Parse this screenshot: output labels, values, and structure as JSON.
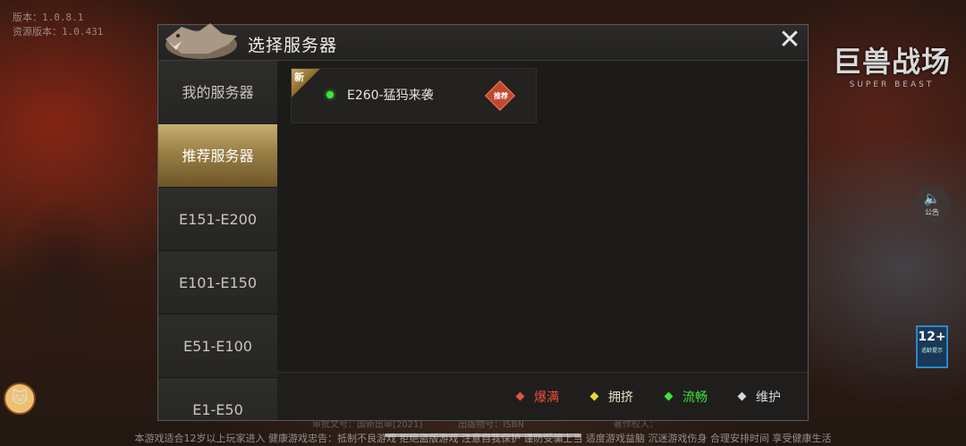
{
  "version_lines": [
    "版本：1.0.8.1",
    "资源版本：1.0.431"
  ],
  "logo": {
    "main": "巨兽战场",
    "sub": "SUPER BEAST"
  },
  "notice_label": "公告",
  "age_badge": {
    "num": "12+",
    "caption": "适龄提示"
  },
  "dialog": {
    "title": "选择服务器",
    "close_glyph": "✕",
    "sidebar": [
      {
        "label": "我的服务器",
        "active": false
      },
      {
        "label": "推荐服务器",
        "active": true
      },
      {
        "label": "E151-E200",
        "active": false
      },
      {
        "label": "E101-E150",
        "active": false
      },
      {
        "label": "E51-E100",
        "active": false
      },
      {
        "label": "E1-E50",
        "active": false
      }
    ],
    "server": {
      "new_tag": "新",
      "name": "E260-猛犸来袭",
      "status_color": "#3ce63c",
      "badge": "推荐"
    },
    "legend": [
      {
        "label": "爆满",
        "color": "#e8503c"
      },
      {
        "label": "拥挤",
        "color": "#e8d23c"
      },
      {
        "label": "流畅",
        "color": "#3ce63c"
      },
      {
        "label": "维护",
        "color": "#d8d8d8"
      }
    ]
  },
  "footer": {
    "dim_line": "审批文号：国新出审[2021]　　　　出版物号：ISBN　　　　　　　　　　著作权人：　　　　　　　　　　　　　　　",
    "line": "本游戏适合12岁以上玩家进入 健康游戏忠告：抵制不良游戏 拒绝盗版游戏 注意自我保护 谨防受骗上当 适度游戏益脑 沉迷游戏伤身 合理安排时间 享受健康生活"
  }
}
